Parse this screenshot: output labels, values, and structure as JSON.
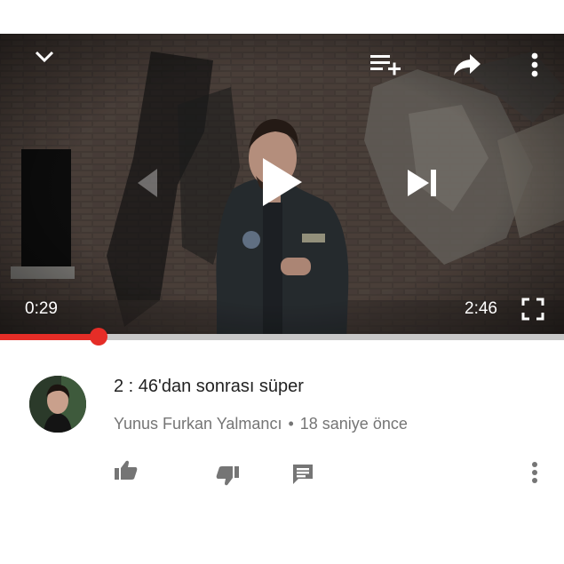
{
  "player": {
    "current_time": "0:29",
    "duration": "2:46",
    "progress": 0.175,
    "icons": {
      "minimize": "chevron-down-icon",
      "add_to_playlist": "playlist-add-icon",
      "share": "share-icon",
      "more": "more-vertical-icon",
      "previous": "skip-previous-icon",
      "play": "play-icon",
      "next": "skip-next-icon",
      "fullscreen": "fullscreen-icon"
    }
  },
  "comment": {
    "text": "2 : 46'dan sonrası süper",
    "author": "Yunus Furkan Yalmancı",
    "separator": "•",
    "time_ago": "18 saniye önce",
    "actions": [
      "thumbs-up-icon",
      "thumbs-down-icon",
      "reply-icon",
      "more-vertical-icon"
    ]
  },
  "colors": {
    "accent": "#e52d27",
    "meta_text": "#757575",
    "comment_text": "#222222"
  }
}
